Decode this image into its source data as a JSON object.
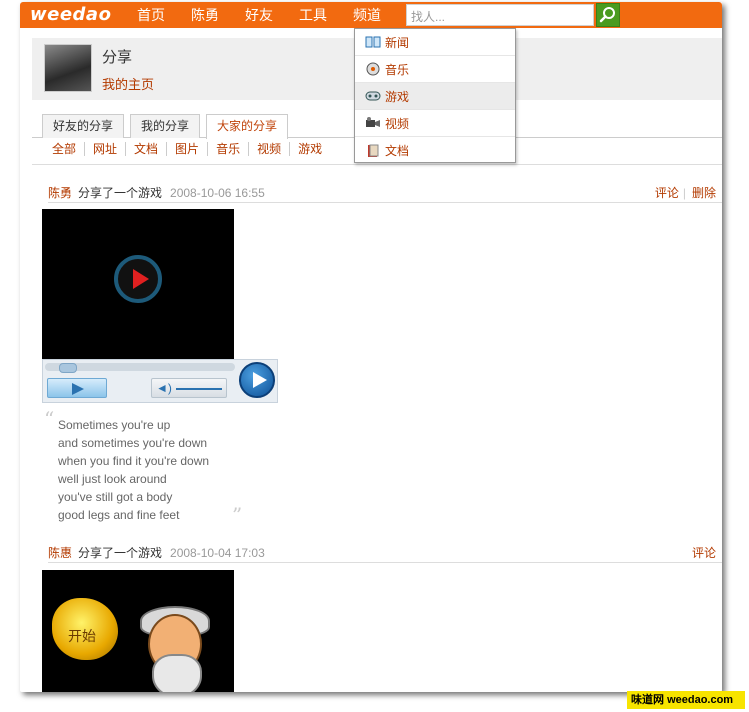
{
  "logo": "weedao",
  "nav": {
    "items": [
      "首页",
      "陈勇",
      "好友",
      "工具",
      "频道"
    ],
    "active_index": 4
  },
  "search": {
    "placeholder": "找人..."
  },
  "dropdown": {
    "items": [
      {
        "label": "新闻",
        "icon": "book-icon"
      },
      {
        "label": "音乐",
        "icon": "music-icon"
      },
      {
        "label": "游戏",
        "icon": "gamepad-icon"
      },
      {
        "label": "视频",
        "icon": "video-camera-icon"
      },
      {
        "label": "文档",
        "icon": "document-icon"
      }
    ],
    "active_index": 2
  },
  "profile": {
    "title": "分享",
    "link": "我的主页"
  },
  "tabs": [
    "好友的分享",
    "我的分享",
    "大家的分享"
  ],
  "active_tab": 2,
  "filters": [
    "全部",
    "网址",
    "文档",
    "图片",
    "音乐",
    "视频",
    "游戏"
  ],
  "shares": [
    {
      "user": "陈勇",
      "action": "分享了一个游戏",
      "time": "2008-10-06 16:55",
      "actions": [
        "评论",
        "删除"
      ],
      "quote": [
        "Sometimes you're up",
        "and sometimes you're down",
        "when you find it you're down",
        "well just look around",
        "you've still got a body",
        "good legs and fine feet"
      ]
    },
    {
      "user": "陈惠",
      "action": "分享了一个游戏",
      "time": "2008-10-04 17:03",
      "actions": [
        "评论"
      ],
      "game_label": "开始"
    }
  ],
  "watermark": {
    "brand": "味道网",
    "domain": "weedao.com"
  },
  "colors": {
    "nav_orange": "#f26a10",
    "link": "#b33a00",
    "search_green": "#4a9b1f"
  }
}
